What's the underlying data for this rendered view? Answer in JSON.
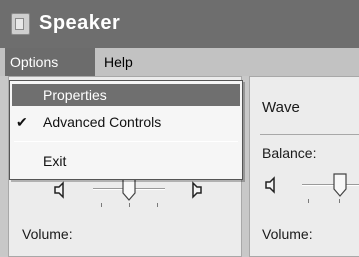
{
  "window": {
    "title": "Speaker",
    "icon": "speaker-app-icon"
  },
  "menubar": {
    "options_label": "Options",
    "help_label": "Help"
  },
  "options_menu": {
    "items": [
      {
        "label": "Properties",
        "highlighted": true
      },
      {
        "label": "Advanced Controls",
        "checked": true,
        "check_glyph": "✔"
      },
      {
        "label": "Exit"
      }
    ]
  },
  "left_panel": {
    "volume_label": "Volume:",
    "balance_level": 0.5,
    "left_speaker_icon": "speaker-left-icon",
    "right_speaker_icon": "speaker-right-icon"
  },
  "right_panel": {
    "title": "Wave",
    "balance_label": "Balance:",
    "volume_label": "Volume:",
    "speaker_icon": "speaker-left-icon"
  },
  "colors": {
    "titlebar": "#6e6e6e",
    "menu_highlight": "#6f6f6f",
    "panel_bg": "#ececec"
  }
}
